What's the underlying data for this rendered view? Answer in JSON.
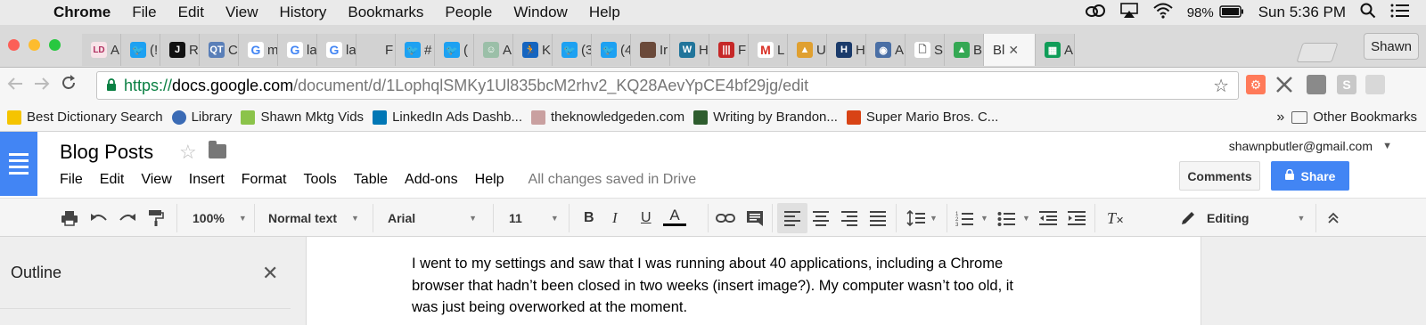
{
  "menubar": {
    "app_name": "Chrome",
    "items": [
      "File",
      "Edit",
      "View",
      "History",
      "Bookmarks",
      "People",
      "Window",
      "Help"
    ],
    "battery": "98%",
    "clock": "Sun 5:36 PM"
  },
  "tabs": [
    {
      "text": "A",
      "icon": "ld-icon",
      "color": "#f8e3e8",
      "glyph": "LD"
    },
    {
      "text": "(!",
      "icon": "twitter-icon",
      "color": "#1da1f2",
      "glyph": "🐦"
    },
    {
      "text": "R",
      "icon": "red-logo-icon",
      "color": "#111111",
      "glyph": "J"
    },
    {
      "text": "C",
      "icon": "qt-icon",
      "color": "#5a7fb8",
      "glyph": "QT"
    },
    {
      "text": "m",
      "icon": "google-icon",
      "color": "#ffffff",
      "glyph": "G"
    },
    {
      "text": "la",
      "icon": "google-icon",
      "color": "#ffffff",
      "glyph": "G"
    },
    {
      "text": "la",
      "icon": "google-icon",
      "color": "#ffffff",
      "glyph": "G"
    },
    {
      "text": "F",
      "icon": "blank-icon",
      "color": "#d2d2d2",
      "glyph": ""
    },
    {
      "text": "#",
      "icon": "twitter-icon",
      "color": "#1da1f2",
      "glyph": "🐦"
    },
    {
      "text": "(",
      "icon": "twitter-icon",
      "color": "#1da1f2",
      "glyph": "🐦"
    },
    {
      "text": "A",
      "icon": "person-icon",
      "color": "#9bbfa8",
      "glyph": "☺"
    },
    {
      "text": "K",
      "icon": "runner-icon",
      "color": "#1565c0",
      "glyph": "🏃"
    },
    {
      "text": "(3",
      "icon": "twitter-icon",
      "color": "#1da1f2",
      "glyph": "🐦"
    },
    {
      "text": "(4",
      "icon": "twitter-icon",
      "color": "#1da1f2",
      "glyph": "🐦"
    },
    {
      "text": "Ir",
      "icon": "profile-photo-icon",
      "color": "#6b4a3a",
      "glyph": ""
    },
    {
      "text": "H",
      "icon": "wordpress-icon",
      "color": "#21759b",
      "glyph": "W"
    },
    {
      "text": "F",
      "icon": "bars-icon",
      "color": "#c62828",
      "glyph": "|||"
    },
    {
      "text": "L",
      "icon": "gmail-icon",
      "color": "#ffffff",
      "glyph": "M"
    },
    {
      "text": "U",
      "icon": "mountain-icon",
      "color": "#e0a030",
      "glyph": "▲"
    },
    {
      "text": "H",
      "icon": "h-logo-icon",
      "color": "#1a3a6a",
      "glyph": "H"
    },
    {
      "text": "A",
      "icon": "globe-icon",
      "color": "#4a6fa5",
      "glyph": "◉"
    },
    {
      "text": "S",
      "icon": "document-icon",
      "color": "#ffffff",
      "glyph": "🗋"
    },
    {
      "text": "B",
      "icon": "google-drive-icon",
      "color": "#34a853",
      "glyph": "▲"
    },
    {
      "text": "Bl",
      "icon": "google-docs-icon",
      "color": "#4285f4",
      "glyph": "",
      "active": true
    },
    {
      "text": "A",
      "icon": "google-sheets-icon",
      "color": "#0f9d58",
      "glyph": "▦"
    }
  ],
  "profile_button": "Shawn",
  "omnibox": {
    "scheme": "https://",
    "host": "docs.google.com",
    "path": "/document/d/1LophqlSMKy1Ul835bcM2rhv2_KQ28AevYpCE4bf29jg/edit"
  },
  "bookmarks": [
    {
      "label": "Best Dictionary Search",
      "icon": "dictionary-icon",
      "color": "#f5c400"
    },
    {
      "label": "Library",
      "icon": "globe-icon",
      "color": "#3b6bb5"
    },
    {
      "label": "Shawn Mktg Vids",
      "icon": "s-logo-icon",
      "color": "#8bc34a"
    },
    {
      "label": "LinkedIn Ads Dashb...",
      "icon": "linkedin-icon",
      "color": "#0077b5"
    },
    {
      "label": "theknowledgeden.com",
      "icon": "dash-icon",
      "color": "#c9a0a0"
    },
    {
      "label": "Writing by Brandon...",
      "icon": "dragon-icon",
      "color": "#2e5d2e"
    },
    {
      "label": "Super Mario Bros. C...",
      "icon": "mario-icon",
      "color": "#d84315"
    }
  ],
  "bookmarks_overflow": "»",
  "other_bookmarks": "Other Bookmarks",
  "doc": {
    "title": "Blog Posts",
    "menu": [
      "File",
      "Edit",
      "View",
      "Insert",
      "Format",
      "Tools",
      "Table",
      "Add-ons",
      "Help"
    ],
    "save_status": "All changes saved in Drive",
    "account": "shawnpbutler@gmail.com",
    "comments_label": "Comments",
    "share_label": "Share"
  },
  "format_toolbar": {
    "zoom": "100%",
    "style": "Normal text",
    "font": "Arial",
    "size": "11",
    "mode": "Editing"
  },
  "outline": {
    "title": "Outline"
  },
  "body_lines": [
    "I went to my settings and saw that I was running about 40 applications, including a Chrome",
    "browser that hadn’t been closed in two weeks (insert image?). My computer wasn’t too old, it",
    "was just being overworked at the moment."
  ]
}
